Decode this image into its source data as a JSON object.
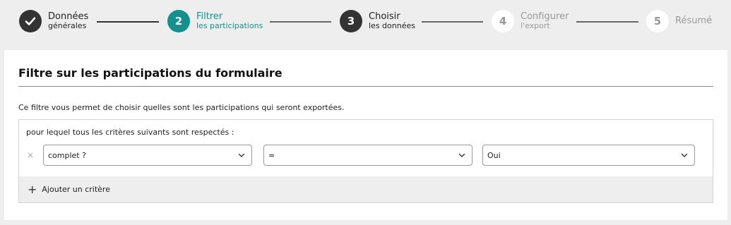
{
  "stepper": {
    "steps": [
      {
        "number": "",
        "main": "Données",
        "sub": "générales",
        "state": "done"
      },
      {
        "number": "2",
        "main": "Filtrer",
        "sub": "les participations",
        "state": "active"
      },
      {
        "number": "3",
        "main": "Choisir",
        "sub": "les données",
        "state": "dark"
      },
      {
        "number": "4",
        "main": "Configurer",
        "sub": "l'export",
        "state": "future"
      },
      {
        "number": "5",
        "main": "Résumé",
        "sub": "",
        "state": "future"
      }
    ],
    "check_icon": "check-icon"
  },
  "card": {
    "title": "Filtre sur les participations du formulaire",
    "description": "Ce filtre vous permet de choisir quelles sont les participations qui seront exportées."
  },
  "filter": {
    "heading": "pour lequel tous les critères suivants sont respectés :",
    "remove_symbol": "×",
    "criteria": [
      {
        "field": "complet ?",
        "operator": "=",
        "value": "Oui"
      }
    ],
    "add_symbol": "+",
    "add_label": "Ajouter un critère"
  },
  "colors": {
    "accent": "#168f8f",
    "dark": "#333333",
    "muted": "#999999",
    "background": "#eeeeee"
  }
}
